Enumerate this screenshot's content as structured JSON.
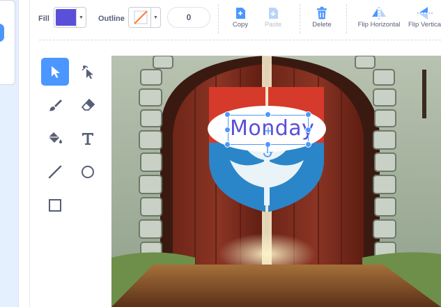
{
  "toolbar": {
    "fill_label": "Fill",
    "fill_color": "#5b4fd9",
    "outline_label": "Outline",
    "outline_value": "0",
    "copy_label": "Copy",
    "paste_label": "Paste",
    "delete_label": "Delete",
    "flip_h_label": "Flip Horizontal",
    "flip_v_label": "Flip Vertica"
  },
  "tools": [
    "select-tool",
    "reshape-tool",
    "brush-tool",
    "eraser-tool",
    "fill-tool",
    "text-tool",
    "line-tool",
    "circle-tool",
    "rectangle-tool"
  ],
  "canvas": {
    "text": "Monday",
    "text_color": "#5b4fd9",
    "accent": "#4c97ff"
  }
}
